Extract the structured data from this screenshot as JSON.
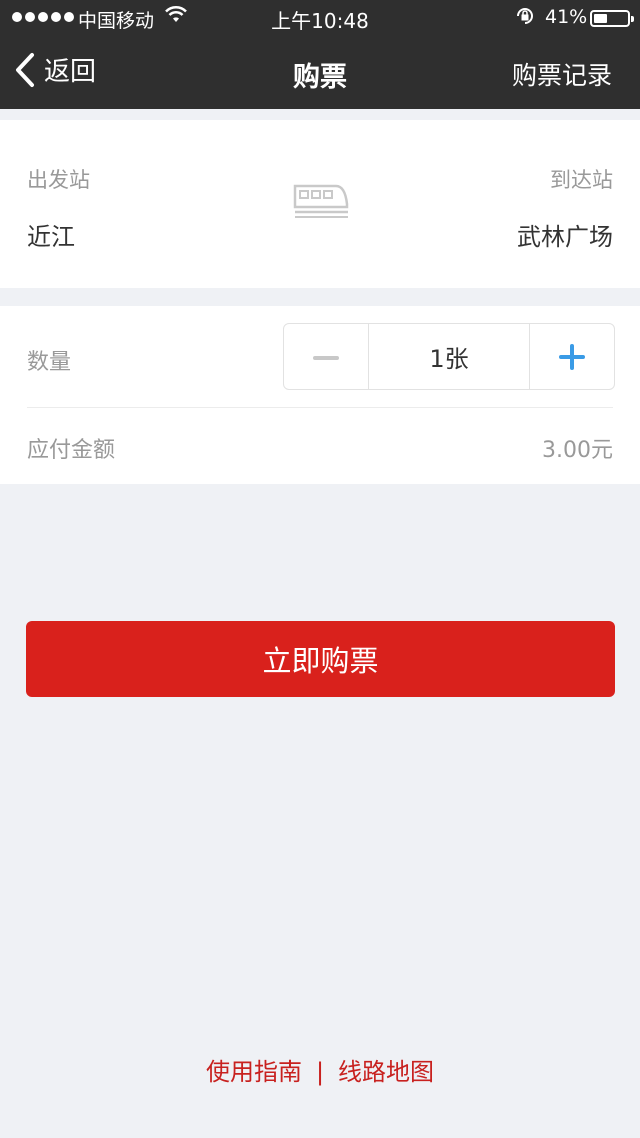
{
  "status_bar": {
    "carrier": "中国移动",
    "time": "上午10:48",
    "battery": "41%",
    "battery_level": 0.41
  },
  "nav": {
    "back_label": "返回",
    "title": "购票",
    "right_action": "购票记录"
  },
  "stations": {
    "departure_label": "出发站",
    "departure_name": "近江",
    "arrival_label": "到达站",
    "arrival_name": "武林广场"
  },
  "order": {
    "quantity_label": "数量",
    "quantity_value": "1张",
    "amount_label": "应付金额",
    "amount_value": "3.00元"
  },
  "buy_button": "立即购票",
  "footer": {
    "guide_link": "使用指南",
    "separator": "|",
    "map_link": "线路地图"
  },
  "colors": {
    "nav_bg": "#2f2f2f",
    "accent_red": "#d9211c",
    "plus_blue": "#3a9be6",
    "page_bg": "#eff1f5"
  },
  "icons": [
    "signal-icon",
    "wifi-icon",
    "orientation-lock-icon",
    "battery-icon",
    "back-chevron-icon",
    "train-icon",
    "minus-icon",
    "plus-icon"
  ]
}
